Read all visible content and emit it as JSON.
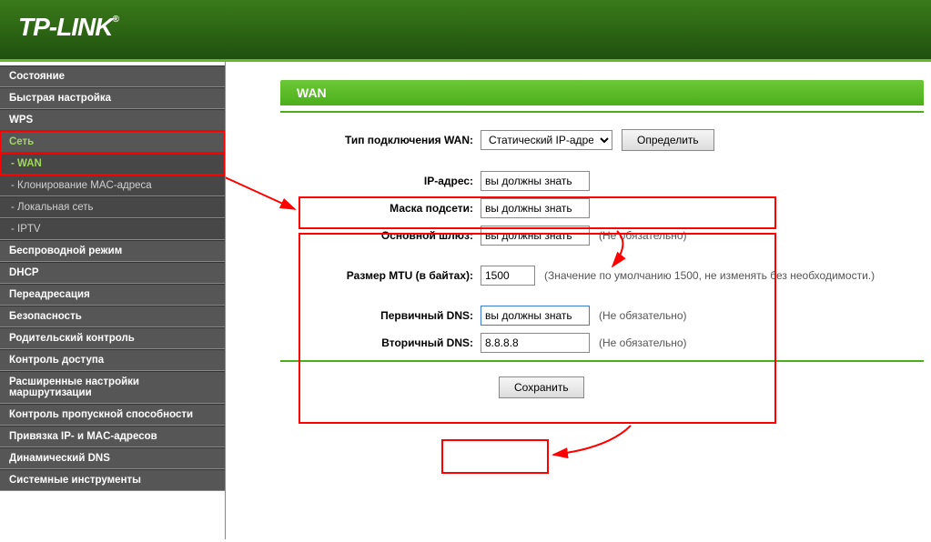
{
  "brand": "TP-LINK",
  "panelTitle": "WAN",
  "sidebar": {
    "items": [
      {
        "label": "Состояние",
        "type": "top"
      },
      {
        "label": "Быстрая настройка",
        "type": "top"
      },
      {
        "label": "WPS",
        "type": "top"
      },
      {
        "label": "Сеть",
        "type": "top",
        "selected": "parent"
      },
      {
        "label": "- WAN",
        "type": "sub",
        "selected": "sub"
      },
      {
        "label": "- Клонирование MAC-адреса",
        "type": "sub"
      },
      {
        "label": "- Локальная сеть",
        "type": "sub"
      },
      {
        "label": "- IPTV",
        "type": "sub"
      },
      {
        "label": "Беспроводной режим",
        "type": "top"
      },
      {
        "label": "DHCP",
        "type": "top"
      },
      {
        "label": "Переадресация",
        "type": "top"
      },
      {
        "label": "Безопасность",
        "type": "top"
      },
      {
        "label": "Родительский контроль",
        "type": "top"
      },
      {
        "label": "Контроль доступа",
        "type": "top"
      },
      {
        "label": "Расширенные настройки маршрутизации",
        "type": "top"
      },
      {
        "label": "Контроль пропускной способности",
        "type": "top"
      },
      {
        "label": "Привязка IP- и MAC-адресов",
        "type": "top"
      },
      {
        "label": "Динамический DNS",
        "type": "top"
      },
      {
        "label": "Системные инструменты",
        "type": "top"
      }
    ]
  },
  "form": {
    "wanTypeLabel": "Тип подключения WAN:",
    "wanTypeValue": "Статический IP-адрес",
    "detectBtn": "Определить",
    "ipLabel": "IP-адрес:",
    "ipValue": "вы должны знать",
    "maskLabel": "Маска подсети:",
    "maskValue": "вы должны знать",
    "gwLabel": "Основной шлюз:",
    "gwValue": "вы должны знать",
    "gwHint": "(Не обязательно)",
    "mtuLabel": "Размер MTU (в байтах):",
    "mtuValue": "1500",
    "mtuHint": "(Значение по умолчанию 1500, не изменять без необходимости.)",
    "dns1Label": "Первичный DNS:",
    "dns1Value": "вы должны знать",
    "dns1Hint": "(Не обязательно)",
    "dns2Label": "Вторичный DNS:",
    "dns2Value": "8.8.8.8",
    "dns2Hint": "(Не обязательно)",
    "saveBtn": "Сохранить"
  }
}
